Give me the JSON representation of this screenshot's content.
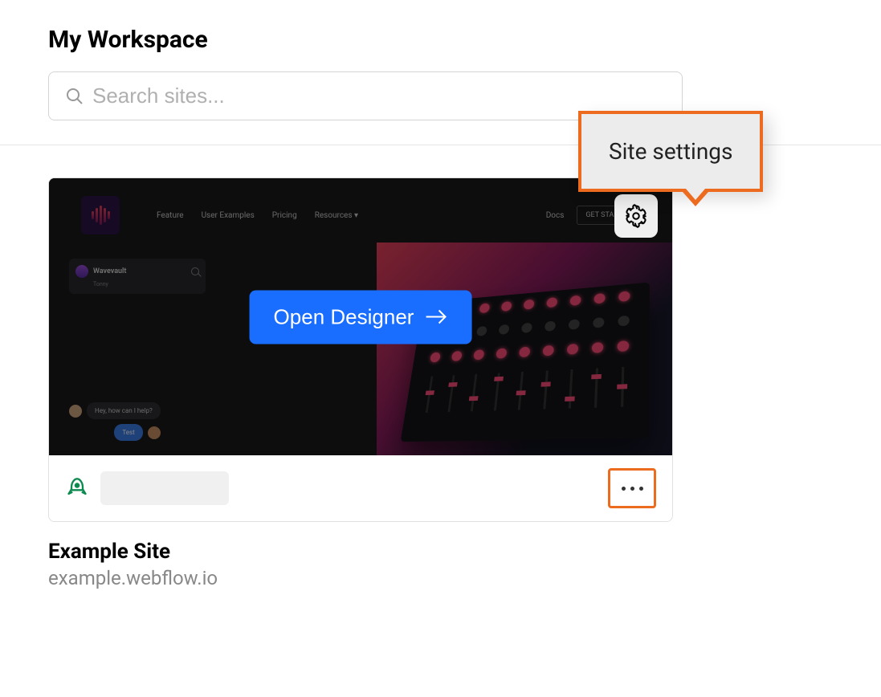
{
  "page": {
    "title": "My Workspace"
  },
  "search": {
    "placeholder": "Search sites...",
    "value": ""
  },
  "tooltip": {
    "label": "Site settings"
  },
  "site": {
    "name": "Example Site",
    "url": "example.webflow.io",
    "open_button_label": "Open Designer",
    "preview_nav": {
      "items": [
        "Feature",
        "User Examples",
        "Pricing",
        "Resources"
      ],
      "docs_label": "Docs",
      "cta_label": "GET STARTED"
    },
    "preview_panel": {
      "title": "Wavevault",
      "subtitle": "Tonny"
    },
    "preview_chat": {
      "incoming": "Hey, how can I help?",
      "outgoing": "Test"
    }
  },
  "colors": {
    "primary_button": "#1a6eff",
    "highlight_border": "#ec6b1f",
    "rocket_icon": "#0d8a4f"
  }
}
